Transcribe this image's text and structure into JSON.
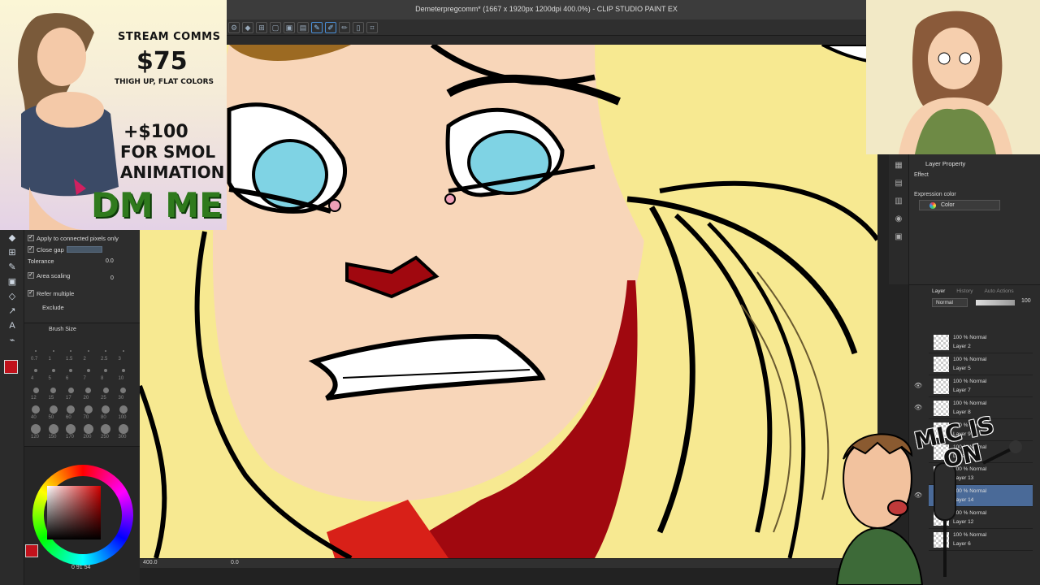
{
  "window": {
    "title": "Demeterpregcomm* (1667 x 1920px 1200dpi 400.0%) - CLIP STUDIO PAINT EX"
  },
  "promo": {
    "title": "STREAM COMMS",
    "price": "$75",
    "subtitle": "THIGH UP, FLAT COLORS",
    "extra_line1": "+$100",
    "extra_line2": "FOR SMOL",
    "extra_line3": "ANIMATION",
    "cta": "DM ME"
  },
  "tool_property": {
    "apply_connected": "Apply to connected pixels only",
    "close_gap": "Close gap",
    "tolerance_label": "Tolerance",
    "tolerance_value": "0.0",
    "area_scaling_label": "Area scaling",
    "area_scaling_value": "0",
    "refer_multiple": "Refer multiple",
    "exclude": "Exclude"
  },
  "brush_size": {
    "title": "Brush Size",
    "row1": [
      "0.7",
      "1",
      "1.5",
      "2",
      "2.5",
      "3"
    ],
    "row2": [
      "4",
      "5",
      "6",
      "7",
      "8",
      "10"
    ],
    "row3": [
      "12",
      "15",
      "17",
      "20",
      "25",
      "30"
    ],
    "row4": [
      "40",
      "50",
      "60",
      "70",
      "80",
      "100"
    ],
    "row5": [
      "120",
      "150",
      "170",
      "200",
      "250",
      "300"
    ]
  },
  "color_wheel": {
    "main_color": "#c1121c",
    "readout": "0   91   54"
  },
  "layer_property": {
    "tab": "Layer Property",
    "effect_label": "Effect",
    "expression_label": "Expression color",
    "expression_value": "Color"
  },
  "layer_panel": {
    "tabs": [
      "Layer",
      "History",
      "Auto Actions"
    ],
    "blend_mode": "Normal",
    "opacity": "100",
    "layers": [
      {
        "mode": "100 % Normal",
        "name": "Layer 2",
        "visible": false,
        "selected": false
      },
      {
        "mode": "100 % Normal",
        "name": "Layer 5",
        "visible": false,
        "selected": false
      },
      {
        "mode": "100 % Normal",
        "name": "Layer 7",
        "visible": true,
        "selected": false
      },
      {
        "mode": "100 % Normal",
        "name": "Layer 8",
        "visible": true,
        "selected": false
      },
      {
        "mode": "100 % Normal",
        "name": "Layer 9",
        "visible": false,
        "selected": false
      },
      {
        "mode": "100 % Normal",
        "name": "Layer 11",
        "visible": false,
        "selected": false
      },
      {
        "mode": "100 % Normal",
        "name": "Layer 13",
        "visible": false,
        "selected": false
      },
      {
        "mode": "100 % Normal",
        "name": "Layer 14",
        "visible": true,
        "selected": true
      },
      {
        "mode": "100 % Normal",
        "name": "Layer 12",
        "visible": false,
        "selected": false
      },
      {
        "mode": "100 % Normal",
        "name": "Layer 6",
        "visible": false,
        "selected": false
      }
    ]
  },
  "status": {
    "zoom": "400.0",
    "rotation": "0.0"
  },
  "mic_overlay": {
    "text_line1": "MIC IS",
    "text_line2": "ON"
  }
}
